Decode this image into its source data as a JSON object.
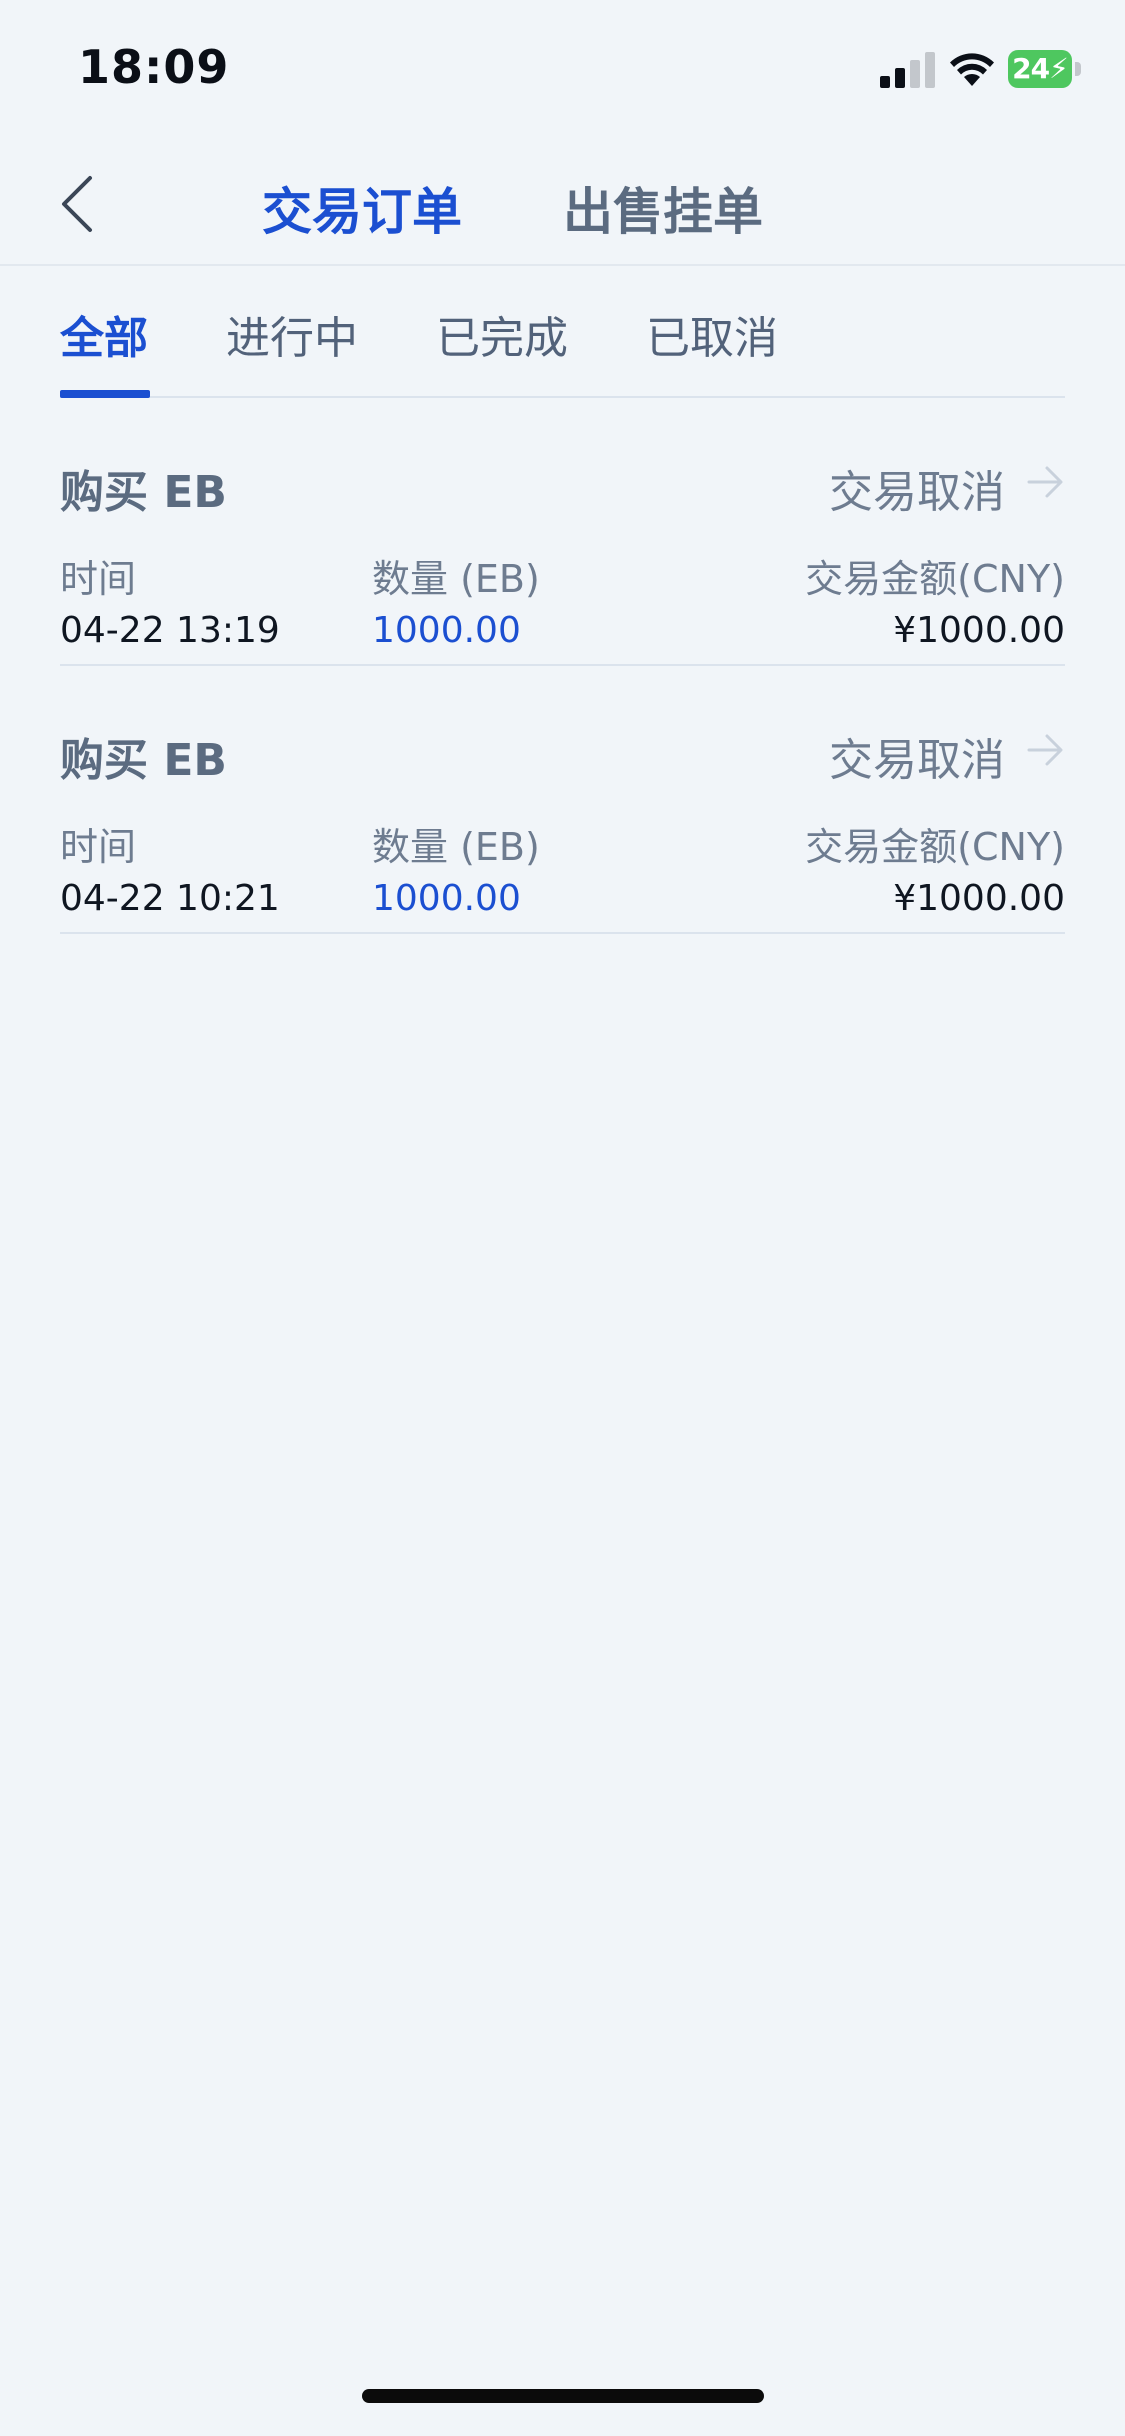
{
  "status_bar": {
    "time": "18:09",
    "battery_level": "24",
    "signal_icon": "cellular-signal-icon",
    "wifi_icon": "wifi-icon",
    "battery_icon": "battery-charging-icon"
  },
  "header": {
    "back_icon": "chevron-left-icon",
    "tabs": [
      {
        "label": "交易订单",
        "active": true
      },
      {
        "label": "出售挂单",
        "active": false
      }
    ]
  },
  "filters": {
    "tabs": [
      {
        "label": "全部",
        "active": true
      },
      {
        "label": "进行中",
        "active": false
      },
      {
        "label": "已完成",
        "active": false
      },
      {
        "label": "已取消",
        "active": false
      }
    ]
  },
  "orders": [
    {
      "title": "购买 EB",
      "status": "交易取消",
      "time_label": "时间",
      "time": "04-22 13:19",
      "qty_label": "数量 (EB)",
      "qty": "1000.00",
      "amount_label": "交易金额(CNY)",
      "amount": "¥1000.00"
    },
    {
      "title": "购买 EB",
      "status": "交易取消",
      "time_label": "时间",
      "time": "04-22 10:21",
      "qty_label": "数量 (EB)",
      "qty": "1000.00",
      "amount_label": "交易金额(CNY)",
      "amount": "¥1000.00"
    }
  ],
  "colors": {
    "accent": "#1b4fd1",
    "background": "#f1f5f9",
    "muted_text": "#6e7c90",
    "battery": "#4ec75f"
  }
}
